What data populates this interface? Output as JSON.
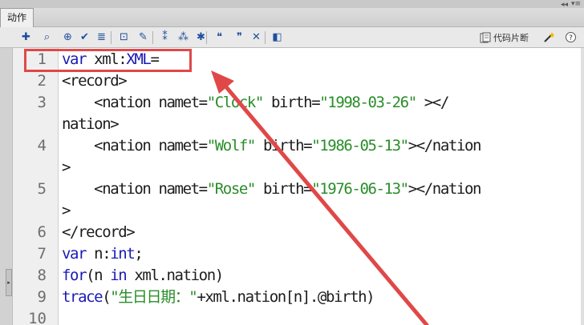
{
  "panel": {
    "tab_label": "动作",
    "collapse_glyph": "◂◂",
    "menu_glyph": "▾≡"
  },
  "toolbar": {
    "icons": [
      {
        "name": "add-statement-icon",
        "glyph": "✚"
      },
      {
        "name": "find-icon",
        "glyph": "⌕"
      },
      {
        "name": "insert-target-path-icon",
        "glyph": "⊕"
      },
      {
        "name": "check-syntax-icon",
        "glyph": "✔"
      },
      {
        "name": "auto-format-icon",
        "glyph": "≣"
      },
      {
        "name": "show-code-hint-icon",
        "glyph": "⊡"
      },
      {
        "name": "debug-options-icon",
        "glyph": "✎"
      },
      {
        "name": "collapse-between-braces-icon",
        "glyph": "⁑"
      },
      {
        "name": "collapse-selection-icon",
        "glyph": "⁂"
      },
      {
        "name": "expand-all-icon",
        "glyph": "✱"
      },
      {
        "name": "apply-block-comment-icon",
        "glyph": "❝"
      },
      {
        "name": "apply-line-comment-icon",
        "glyph": "❞"
      },
      {
        "name": "remove-comment-icon",
        "glyph": "✕"
      },
      {
        "name": "show-hide-toolbox-icon",
        "glyph": "◧"
      }
    ],
    "snippets_label": "代码片断",
    "snippets_icon": "code-snippets-icon",
    "wizard_icon": "magic-wand-icon"
  },
  "side_handle_glyph": "▸",
  "editor": {
    "line_numbers": [
      "1",
      "2",
      "3",
      "",
      "4",
      "",
      "5",
      "",
      "6",
      "7",
      "8",
      "9",
      "10"
    ],
    "lines": [
      [
        {
          "t": "var",
          "c": "kw"
        },
        {
          "t": " xml:",
          "c": ""
        },
        {
          "t": "XML",
          "c": "kw"
        },
        {
          "t": "=",
          "c": ""
        }
      ],
      [
        {
          "t": "<record>",
          "c": ""
        }
      ],
      [
        {
          "t": "    <nation namet=",
          "c": ""
        },
        {
          "t": "\"Clock\"",
          "c": "str"
        },
        {
          "t": " birth=",
          "c": ""
        },
        {
          "t": "\"1998-03-26\"",
          "c": "str"
        },
        {
          "t": " ></",
          "c": ""
        }
      ],
      [
        {
          "t": "nation>",
          "c": ""
        }
      ],
      [
        {
          "t": "    <nation namet=",
          "c": ""
        },
        {
          "t": "\"Wolf\"",
          "c": "str"
        },
        {
          "t": " birth=",
          "c": ""
        },
        {
          "t": "\"1986-05-13\"",
          "c": "str"
        },
        {
          "t": "></nation",
          "c": ""
        }
      ],
      [
        {
          "t": ">",
          "c": ""
        }
      ],
      [
        {
          "t": "    <nation namet=",
          "c": ""
        },
        {
          "t": "\"Rose\"",
          "c": "str"
        },
        {
          "t": " birth=",
          "c": ""
        },
        {
          "t": "\"1976-06-13\"",
          "c": "str"
        },
        {
          "t": "></nation",
          "c": ""
        }
      ],
      [
        {
          "t": ">",
          "c": ""
        }
      ],
      [
        {
          "t": "</record>",
          "c": ""
        }
      ],
      [
        {
          "t": "var",
          "c": "kw"
        },
        {
          "t": " n:",
          "c": ""
        },
        {
          "t": "int",
          "c": "kw"
        },
        {
          "t": ";",
          "c": ""
        }
      ],
      [
        {
          "t": "for",
          "c": "kw"
        },
        {
          "t": "(n ",
          "c": ""
        },
        {
          "t": "in",
          "c": "kw"
        },
        {
          "t": " xml.nation)",
          "c": ""
        }
      ],
      [
        {
          "t": "trace",
          "c": "kw"
        },
        {
          "t": "(",
          "c": ""
        },
        {
          "t": "\"生日日期：\"",
          "c": "str"
        },
        {
          "t": "+xml.nation[n].@birth)",
          "c": ""
        }
      ],
      [
        {
          "t": "",
          "c": ""
        }
      ]
    ]
  },
  "colors": {
    "keyword": "#1b1bb5",
    "string": "#2a8d2a",
    "annotation": "#e04848"
  }
}
